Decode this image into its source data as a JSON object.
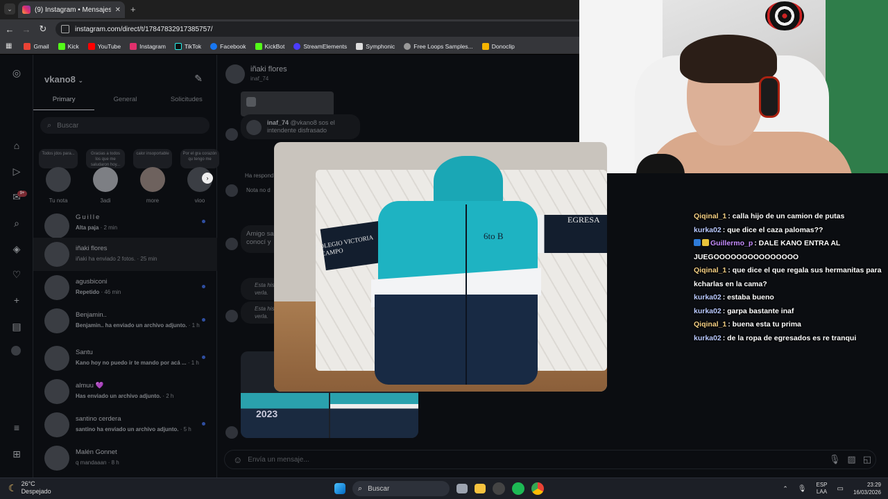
{
  "browser": {
    "tab_title": "(9) Instagram • Mensajes",
    "url": "instagram.com/direct/t/17847832917385757/",
    "bookmarks": [
      "Gmail",
      "Kick",
      "YouTube",
      "Instagram",
      "TikTok",
      "Facebook",
      "KickBot",
      "StreamElements",
      "Symphonic",
      "Free Loops Samples...",
      "Donoclip"
    ]
  },
  "rail": {
    "badge": "9+"
  },
  "inbox": {
    "account": "vkano8",
    "tabs": [
      "Primary",
      "General",
      "Solicitudes"
    ],
    "search_placeholder": "Buscar",
    "notes": [
      {
        "bubble": "Todos jdos para...",
        "name": "Tu nota"
      },
      {
        "bubble": "Gracias a todos los que me saludaron hoy...",
        "name": "3adi"
      },
      {
        "bubble": "calor insoportable",
        "name": "more"
      },
      {
        "bubble": "Por el gra corazón qu tengo me",
        "name": "vioo"
      }
    ],
    "threads": [
      {
        "name": "Guille",
        "preview": "Alta paja",
        "time": "· 2 min"
      },
      {
        "name": "iñaki flores",
        "preview": "iñaki ha enviado 2 fotos.",
        "time": "· 25 min"
      },
      {
        "name": "agusbiconi",
        "preview": "Repetido",
        "time": "· 46 min"
      },
      {
        "name": "Benjamin..",
        "preview": "Benjamin.. ha enviado un archivo adjunto.",
        "time": "· 1 h"
      },
      {
        "name": "Santu",
        "preview": "Kano hoy no puedo ir te mando por acá ...",
        "time": "· 1 h"
      },
      {
        "name": "almuu 💜",
        "preview": "Has enviado un archivo adjunto.",
        "time": "· 2 h"
      },
      {
        "name": "santino cerdera",
        "preview": "santino ha enviado un archivo adjunto.",
        "time": "· 5 h"
      },
      {
        "name": "Malén Gonnet",
        "preview": "q mandaaan",
        "time": "· 8 h"
      }
    ]
  },
  "chat": {
    "name": "iñaki flores",
    "username": "inaf_74",
    "reply_user": "inaf_74",
    "reply_text": "@vkano8 sos el intendente disfrasado",
    "msg_replied": "Ha respond",
    "msg_note": "Nota no d",
    "msg_amigo": "Amigo sa conocí y",
    "msg_story1": "Esta his verla.",
    "msg_story2": "Esta his verla.",
    "composer_placeholder": "Envía un mensaje..."
  },
  "photo": {
    "jacket_text_left": "COLEGIO VICTORIA OCAMPO",
    "jacket_text_center": "6to B",
    "jacket_text_right": "EGRESA",
    "thumb_text": "2023"
  },
  "stream_chat": [
    {
      "user": "Qiqinal_1",
      "color": "#f5cf83",
      "text": ": calla hijo de un camion de putas"
    },
    {
      "user": "kurka02",
      "color": "#b9c9ff",
      "text": ": que dice el caza palomas??"
    },
    {
      "user": "Guillermo_p",
      "color": "#c58cff",
      "text": ": DALE KANO ENTRA AL JUEGOOOOOOOOOOOOOOO",
      "badges": true
    },
    {
      "user": "Qiqinal_1",
      "color": "#f5cf83",
      "text": ": que dice el que regala sus hermanitas para kcharlas en la cama?"
    },
    {
      "user": "kurka02",
      "color": "#b9c9ff",
      "text": ": estaba bueno"
    },
    {
      "user": "kurka02",
      "color": "#b9c9ff",
      "text": ": garpa bastante inaf"
    },
    {
      "user": "Qiqinal_1",
      "color": "#f5cf83",
      "text": ": buena esta tu prima"
    },
    {
      "user": "kurka02",
      "color": "#b9c9ff",
      "text": ": de la ropa de egresados es re tranqui"
    }
  ],
  "taskbar": {
    "temp": "26°C",
    "weather": "Despejado",
    "search": "Buscar",
    "lang1": "ESP",
    "lang2": "LAA",
    "time": "23:29",
    "date": "16/03/2026"
  }
}
